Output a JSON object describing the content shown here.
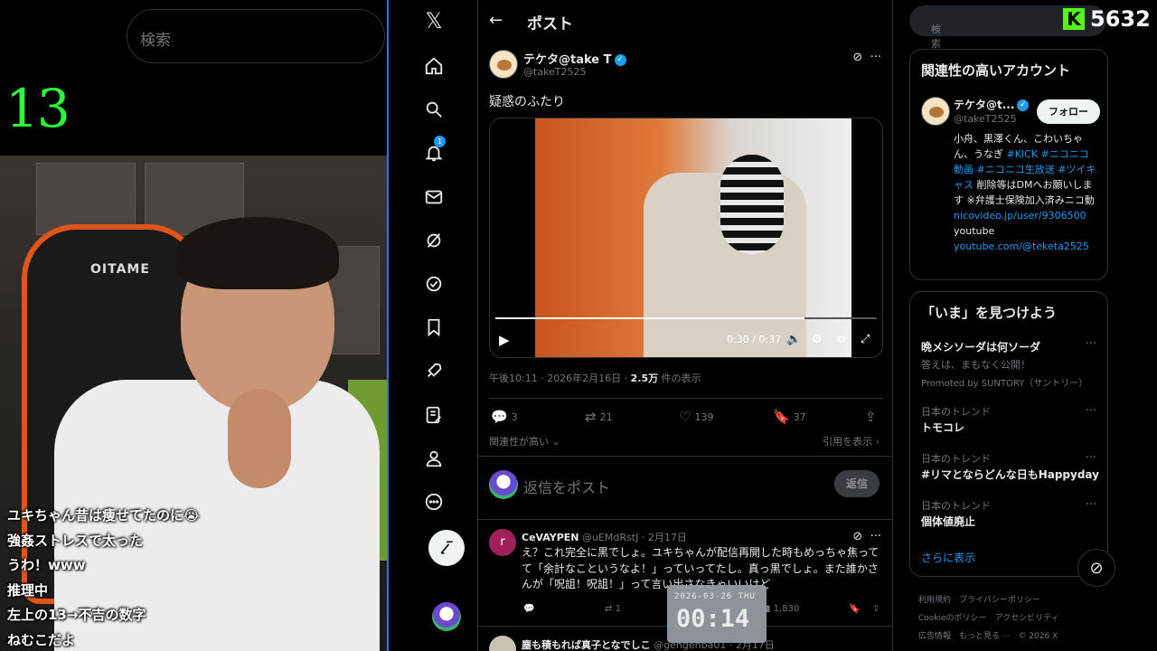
{
  "stream": {
    "search_placeholder": "検索",
    "counter": "13",
    "chair_logo": "OITAME",
    "comments": [
      "ユキちゃん昔は痩せてたのに😭",
      "強姦ストレスで太った",
      "うわ！www",
      "推理中",
      "左上の13→不吉の数字",
      "ねむこだよ"
    ]
  },
  "kick": {
    "viewers": "5632",
    "logo": "K"
  },
  "clock": {
    "date": "2026-03-26 THU",
    "time": "00:14"
  },
  "nav": {
    "logo": "𝕏",
    "notification_count": "1"
  },
  "topbar": {
    "title": "ポスト"
  },
  "post": {
    "author_name": "テケタ@take T",
    "author_handle": "@takeT2525",
    "text": "疑惑のふたり",
    "video_time": "0:30 / 0:37",
    "video_progress": 0.81,
    "timestamp": "午後10:11 · 2026年2月16日 · ",
    "views_count": "2.5万",
    "views_label": " 件の表示",
    "replies": "3",
    "reposts": "21",
    "likes": "139",
    "bookmarks": "37",
    "relevance_label": "関連性が高い",
    "quotes_label": "引用を表示"
  },
  "reply": {
    "placeholder": "返信をポスト",
    "button": "返信"
  },
  "comment1": {
    "avatar_letter": "r",
    "name": "CeVAYPEN",
    "meta": " @uEMdRstJ · 2月17日",
    "text": "え？これ完全に黒でしょ。ユキちゃんが配信再開した時もめっちゃ焦ってて「余計なこというなよ！」っていってたし。真っ黒でしょ。また誰かさんが「呪詛！呪詛！」って言い出さなきゃいいけど",
    "reposts": "1",
    "likes": "3",
    "views": "1,830"
  },
  "comment2": {
    "name": "塵も積もれば真子となでしこ",
    "meta": " @gengenba01 · 2月17日"
  },
  "side": {
    "search_placeholder": "検索",
    "related_title": "関連性の高いアカウント",
    "rec_name": "テケタ@t...",
    "rec_handle": "@takeT2525",
    "follow_label": "フォロー",
    "bio_1": "小舟、黒澤くん、こわいちゃん、うなぎ ",
    "bio_tags": "#KICK #ニコニコ動画 #ニコニコ生放送 #ツイキャス",
    "bio_2": " 削除等はDMへお願いします ※弁護士保険加入済みニコ動",
    "bio_link1": "nicovideo.jp/user/9306500",
    "bio_3": "youtube",
    "bio_link2": "youtube.com/@teketa2525",
    "trends_title": "「いま」を見つけよう",
    "trends": [
      {
        "category": "",
        "name": "晩メシソーダは何ソーダ",
        "sub": "答えは、まもなく公開！",
        "promo": "Promoted by SUNTORY（サントリー）"
      },
      {
        "category": "日本のトレンド",
        "name": "トモコレ"
      },
      {
        "category": "日本のトレンド",
        "name": "#リマとならどんな日もHappyday"
      },
      {
        "category": "日本のトレンド",
        "name": "個体値廃止"
      }
    ],
    "show_more": "さらに表示",
    "footer_1": "利用規約　プライバシーポリシー",
    "footer_2": "Cookieのポリシー　アクセシビリティ",
    "footer_3": "広告情報　もっと見る ···　© 2026 X"
  },
  "colors": {
    "accent": "#1d9bf0",
    "kick_green": "#53fc18",
    "counter_green": "#2bff3a"
  }
}
